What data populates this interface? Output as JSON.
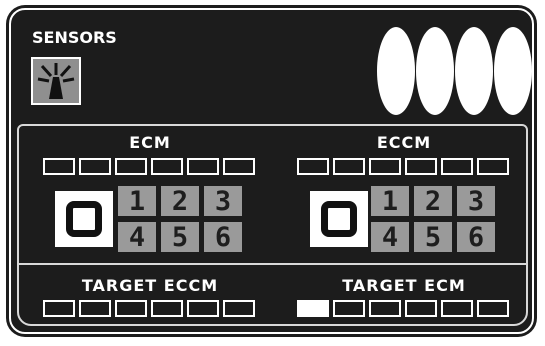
{
  "header": {
    "title": "SENSORS",
    "sensor_icon": "sensor-antenna-icon",
    "status_lights": [
      true,
      true,
      true,
      true
    ]
  },
  "ecm": {
    "label": "ECM",
    "meter": {
      "segments": 6,
      "lit": 0
    },
    "selected": "0",
    "keys": [
      "1",
      "2",
      "3",
      "4",
      "5",
      "6"
    ]
  },
  "eccm": {
    "label": "ECCM",
    "meter": {
      "segments": 6,
      "lit": 0
    },
    "selected": "0",
    "keys": [
      "1",
      "2",
      "3",
      "4",
      "5",
      "6"
    ]
  },
  "target_eccm": {
    "label": "TARGET ECCM",
    "meter": {
      "segments": 6,
      "lit": 0
    }
  },
  "target_ecm": {
    "label": "TARGET ECM",
    "meter": {
      "segments": 6,
      "lit": 1
    }
  },
  "colors": {
    "panel": "#1c1c1c",
    "line": "#ffffff",
    "key": "#9a9a9a"
  }
}
